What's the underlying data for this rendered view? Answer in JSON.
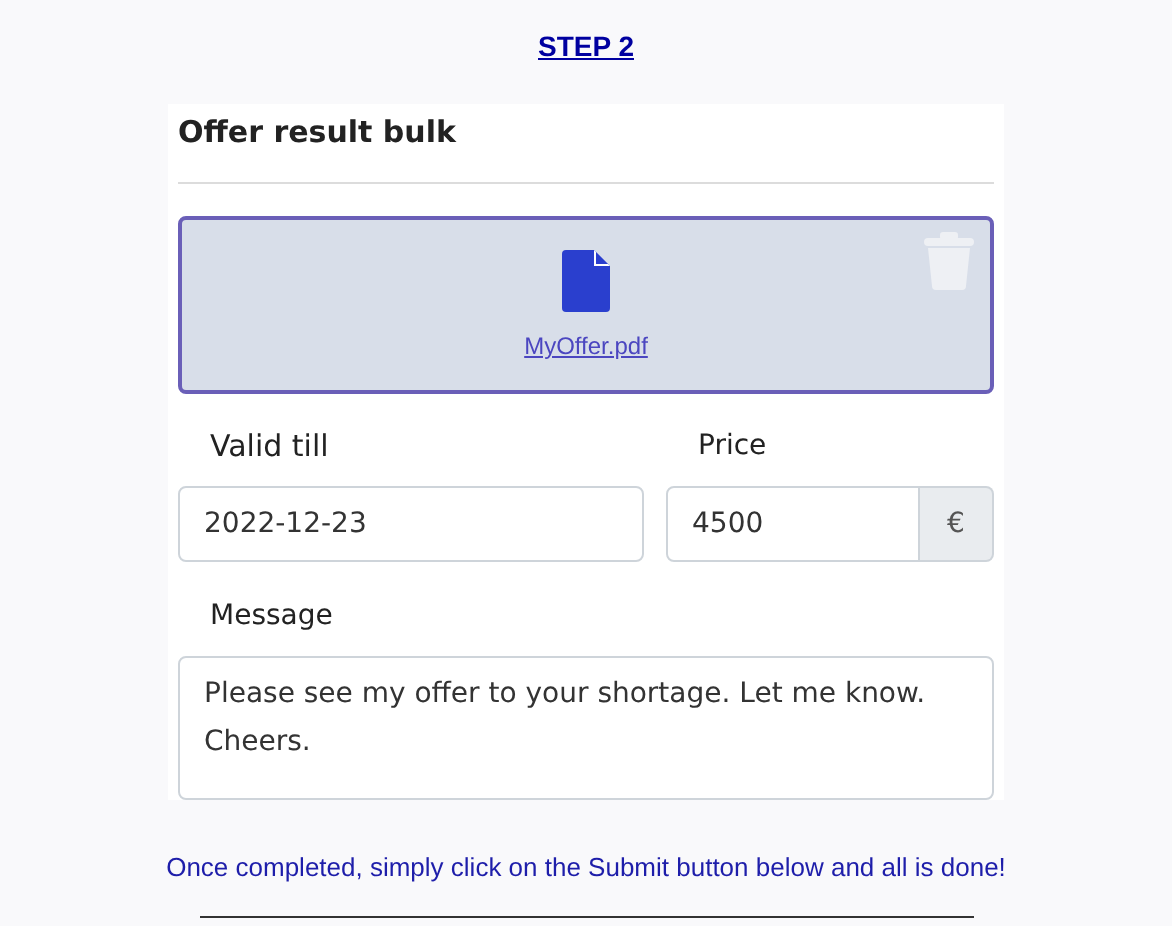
{
  "step_title": "STEP 2",
  "card": {
    "title": "Offer result bulk",
    "attachment": {
      "file_name": "MyOffer.pdf"
    },
    "valid_till": {
      "label": "Valid till",
      "value": "2022-12-23"
    },
    "price": {
      "label": "Price",
      "value": "4500",
      "currency": "€"
    },
    "message": {
      "label": "Message",
      "value": "Please see my offer to your shortage. Let me know.\nCheers."
    }
  },
  "instruction": "Once completed, simply click on the Submit button below and all is done!"
}
